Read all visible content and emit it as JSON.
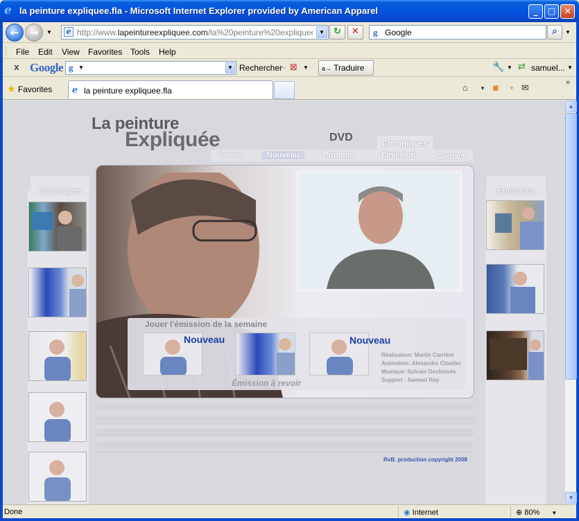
{
  "window": {
    "title": "la peinture expliquee.fla - Microsoft Internet Explorer provided by American Apparel",
    "minimize_glyph": "_",
    "maximize_glyph": "□",
    "close_glyph": "✕"
  },
  "address_bar": {
    "url_prefix": "http://www.",
    "url_domain": "lapeintureexpliquee.com",
    "url_rest": "/la%20peinture%20expliquee.htm",
    "search_engine": "Google",
    "go_glyph": "↻",
    "stop_glyph": "✕"
  },
  "menu": {
    "file": "File",
    "edit": "Edit",
    "view": "View",
    "favorites": "Favorites",
    "tools": "Tools",
    "help": "Help"
  },
  "google_toolbar": {
    "close_glyph": "x",
    "logo": "Google",
    "search_label": "Rechercher",
    "translate_label": "Traduire",
    "translate_icon": "a→",
    "user_label": "samuel...",
    "search_value": ""
  },
  "tabs": {
    "favorites_label": "Favorites",
    "active_tab_label": "la peinture expliquee.fla"
  },
  "site": {
    "title_line1": "La peinture",
    "title_line2": "Expliquée",
    "dvd_label": "DVD",
    "chroniques_tab": "Chroniques",
    "nav": {
      "concept": "Concept",
      "nouveau": "Nouveau",
      "produits": "Produits",
      "emission": "Émission",
      "contact": "Contact"
    },
    "left_heading": "Chroniques",
    "right_heading": "Émissions",
    "play_label": "Jouer l'émission de la semaine",
    "nouveau_1": "Nouveau",
    "nouveau_2": "Nouveau",
    "credits": {
      "realisation": "Réalisation: Martin Carrière",
      "animation": "Animation:   Alexandre Cloutier",
      "musique": "Musique: Sylvain Desfossés",
      "support": "Support : Samuel Roy"
    },
    "revoir_label": "Émission  à revoir",
    "copyright": "RvB. production copyright  2008"
  },
  "status_bar": {
    "status": "Done",
    "zone": "Internet",
    "zoom": "80%"
  },
  "colors": {
    "titlebar_blue": "#0454e0",
    "page_bg": "#d8d8de",
    "link_blue": "#1a3ea8",
    "nav_white": "#ffffff"
  },
  "icons": {
    "back": "back-arrow-icon",
    "forward": "forward-arrow-icon",
    "refresh": "refresh-icon",
    "stop": "stop-icon",
    "search": "magnifier-icon",
    "home": "home-icon",
    "feeds": "rss-icon",
    "mail": "mail-icon"
  }
}
